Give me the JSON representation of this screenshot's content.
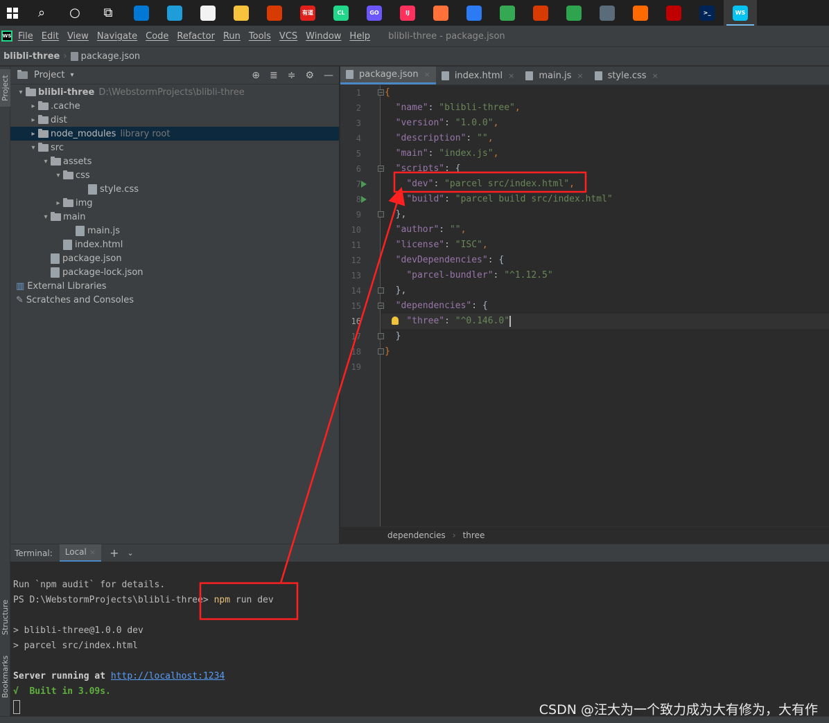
{
  "taskbar": {
    "apps": [
      {
        "name": "search",
        "glyph": "⌕"
      },
      {
        "name": "cortana",
        "glyph": "○"
      },
      {
        "name": "task-view",
        "glyph": "⧉"
      },
      {
        "name": "mail",
        "label": "",
        "color": "#0078d4"
      },
      {
        "name": "edge",
        "label": "",
        "color": "#1f9dd9"
      },
      {
        "name": "store",
        "label": "",
        "color": "#f3f3f3"
      },
      {
        "name": "file-explorer",
        "label": "",
        "color": "#f8c33c"
      },
      {
        "name": "office",
        "label": "",
        "color": "#d83b01"
      },
      {
        "name": "youdao",
        "label": "有道",
        "color": "#e0201b"
      },
      {
        "name": "clion",
        "label": "CL",
        "color": "#21d789"
      },
      {
        "name": "goland",
        "label": "GO",
        "color": "#6b57ff"
      },
      {
        "name": "intellij",
        "label": "IJ",
        "color": "#fe315d"
      },
      {
        "name": "firefox",
        "label": "",
        "color": "#ff7139"
      },
      {
        "name": "app-blue",
        "label": "",
        "color": "#2d7bf4"
      },
      {
        "name": "chrome",
        "label": "",
        "color": "#34a853"
      },
      {
        "name": "office-2",
        "label": "",
        "color": "#d83b01"
      },
      {
        "name": "app-green",
        "label": "",
        "color": "#2ea44f"
      },
      {
        "name": "app-screen",
        "label": "",
        "color": "#5a6b7a"
      },
      {
        "name": "app-orange",
        "label": "",
        "color": "#ff6a00"
      },
      {
        "name": "app-red",
        "label": "",
        "color": "#c00000"
      },
      {
        "name": "powershell",
        "label": ">_",
        "color": "#012456"
      },
      {
        "name": "webstorm",
        "label": "WS",
        "color": "#07c3f2"
      }
    ]
  },
  "menubar": {
    "items": [
      "File",
      "Edit",
      "View",
      "Navigate",
      "Code",
      "Refactor",
      "Run",
      "Tools",
      "VCS",
      "Window",
      "Help"
    ],
    "title": "blibli-three - package.json"
  },
  "breadcrumb": {
    "project": "blibli-three",
    "file": "package.json"
  },
  "stripe": {
    "project": "Project",
    "structure": "Structure",
    "bookmarks": "Bookmarks"
  },
  "project_panel": {
    "title": "Project",
    "tree": [
      {
        "label": "blibli-three",
        "extra": "D:\\WebstormProjects\\blibli-three",
        "type": "folder",
        "arrow": "▾",
        "bold": true
      },
      {
        "label": ".cache",
        "type": "folder",
        "arrow": "▸"
      },
      {
        "label": "dist",
        "type": "folder",
        "arrow": "▸"
      },
      {
        "label": "node_modules",
        "extra": "library root",
        "type": "folder",
        "arrow": "▸",
        "selected": true
      },
      {
        "label": "src",
        "type": "folder",
        "arrow": "▾"
      },
      {
        "label": "assets",
        "type": "folder",
        "arrow": "▾"
      },
      {
        "label": "css",
        "type": "folder",
        "arrow": "▾"
      },
      {
        "label": "style.css",
        "type": "css"
      },
      {
        "label": "img",
        "type": "folder",
        "arrow": "▸"
      },
      {
        "label": "main",
        "type": "folder",
        "arrow": "▾"
      },
      {
        "label": "main.js",
        "type": "js"
      },
      {
        "label": "index.html",
        "type": "html"
      },
      {
        "label": "package.json",
        "type": "json"
      },
      {
        "label": "package-lock.json",
        "type": "json"
      },
      {
        "label": "External Libraries",
        "type": "lib"
      },
      {
        "label": "Scratches and Consoles",
        "type": "scratch"
      }
    ]
  },
  "tabs": [
    {
      "label": "package.json",
      "active": true
    },
    {
      "label": "index.html"
    },
    {
      "label": "main.js"
    },
    {
      "label": "style.css"
    }
  ],
  "code": {
    "lines": [
      "1",
      "2",
      "3",
      "4",
      "5",
      "6",
      "7",
      "8",
      "9",
      "10",
      "11",
      "12",
      "13",
      "14",
      "15",
      "16",
      "17",
      "18",
      "19"
    ],
    "current_line": "16"
  },
  "editor_breadcrumb": {
    "a": "dependencies",
    "b": "three"
  },
  "terminal": {
    "label": "Terminal:",
    "tab": "Local",
    "line1": "Run `npm audit` for details.",
    "prompt": "PS D:\\WebstormProjects\\blibli-three> ",
    "cmd_npm": "npm",
    "cmd_rest": " run dev",
    "out1": "> blibli-three@1.0.0 dev",
    "out2": "> parcel src/index.html",
    "server_label": "Server running at ",
    "server_url": "http://localhost:1234",
    "built": "√  Built in 3.09s."
  },
  "watermark": "CSDN @汪大为一个致力成为大有修为，大有作"
}
